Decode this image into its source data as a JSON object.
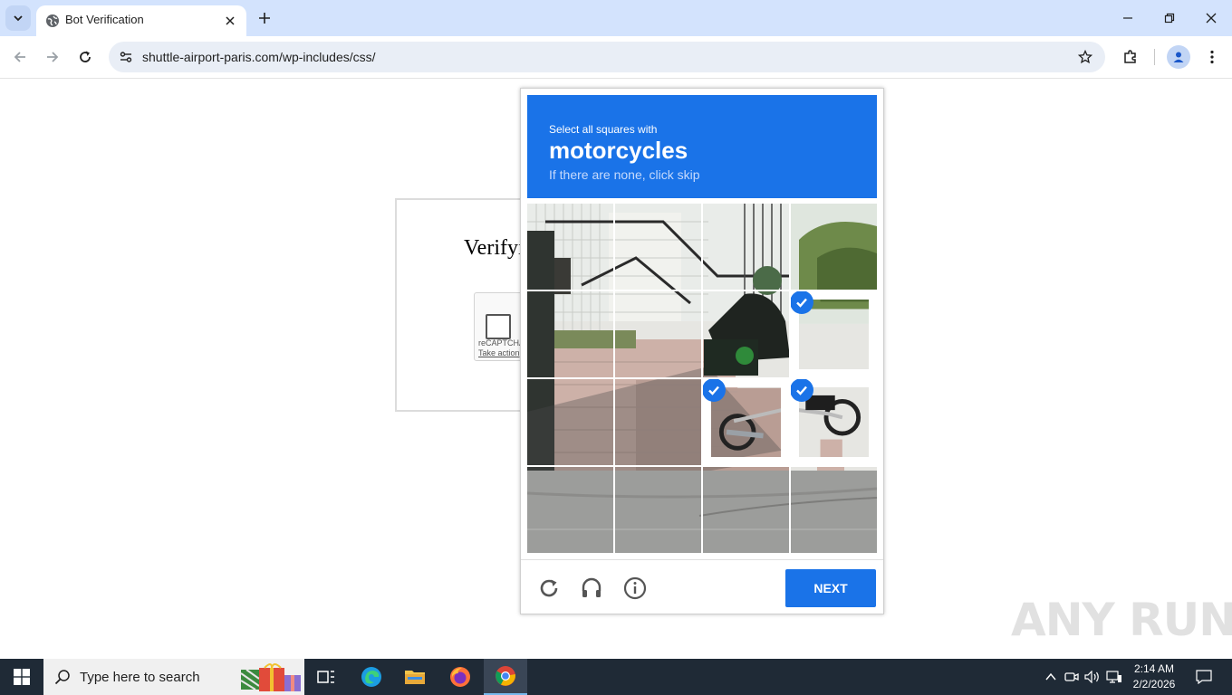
{
  "browser": {
    "tab_title": "Bot Verification",
    "url": "shuttle-airport-paris.com/wp-includes/css/"
  },
  "page": {
    "title": "Verifying",
    "recaptcha_brand": "reCAPTCHA",
    "recaptcha_action": "Take action"
  },
  "challenge": {
    "line1": "Select all squares with",
    "keyword": "motorcycles",
    "line3": "If there are none, click skip",
    "next_label": "NEXT",
    "header_color": "#1a73e8",
    "selected_tiles": [
      8,
      11,
      12
    ]
  },
  "taskbar": {
    "search_placeholder": "Type here to search",
    "time": "2:14 AM",
    "date": "2/2/2026"
  },
  "watermark": "ANY RUN"
}
